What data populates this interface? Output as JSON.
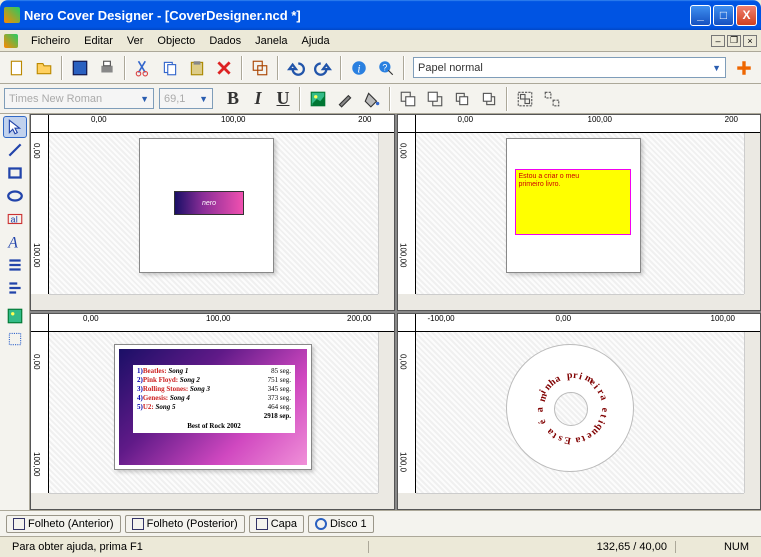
{
  "titlebar": {
    "app": "Nero Cover Designer",
    "doc": "[CoverDesigner.ncd *]"
  },
  "menu": {
    "ficheiro": "Ficheiro",
    "editar": "Editar",
    "ver": "Ver",
    "objecto": "Objecto",
    "dados": "Dados",
    "janela": "Janela",
    "ajuda": "Ajuda"
  },
  "toolbar": {
    "paper_label": "Papel normal"
  },
  "format": {
    "font": "Times New Roman",
    "size": "69,1",
    "bold": "B",
    "italic": "I",
    "under": "U"
  },
  "rulers": {
    "top_left": [
      "0,00",
      "100,00",
      "200"
    ],
    "top_right": [
      "0,00",
      "100,00",
      "200"
    ],
    "bot_left": [
      "0,00",
      "100,00",
      "200,00"
    ],
    "bot_right": [
      "-100,00",
      "0,00",
      "100,00"
    ],
    "v_tl": [
      "0,00",
      "100,00"
    ],
    "v_tr": [
      "0,00",
      "100,00"
    ],
    "v_bl": [
      "0,00",
      "100,00"
    ],
    "v_br": [
      "0,00",
      "100,0"
    ]
  },
  "pane1": {
    "nero": "nero"
  },
  "pane2": {
    "line1": "Estou a criar o meu",
    "line2": "primeiro livro."
  },
  "pane3": {
    "rows": [
      {
        "n": "1)",
        "artist": "Beatles:",
        "song": "Song 1",
        "dur": "85 seg."
      },
      {
        "n": "2)",
        "artist": "Pink Floyd:",
        "song": "Song 2",
        "dur": "751 seg."
      },
      {
        "n": "3)",
        "artist": "Rolling Stones:",
        "song": "Song 3",
        "dur": "345 seg."
      },
      {
        "n": "4)",
        "artist": "Genesis:",
        "song": "Song 4",
        "dur": "373 seg."
      },
      {
        "n": "5)",
        "artist": "U2:",
        "song": "Song 5",
        "dur": "464 seg."
      }
    ],
    "bottom": "Best of Rock 2002",
    "total": "2918 sep."
  },
  "pane4": {
    "text": "Esta é a minha primeira etiqueta"
  },
  "tabs": {
    "t1": "Folheto (Anterior)",
    "t2": "Folheto (Posterior)",
    "t3": "Capa",
    "t4": "Disco 1"
  },
  "status": {
    "help": "Para obter ajuda, prima F1",
    "coord": "132,65 / 40,00",
    "num": "NUM"
  }
}
